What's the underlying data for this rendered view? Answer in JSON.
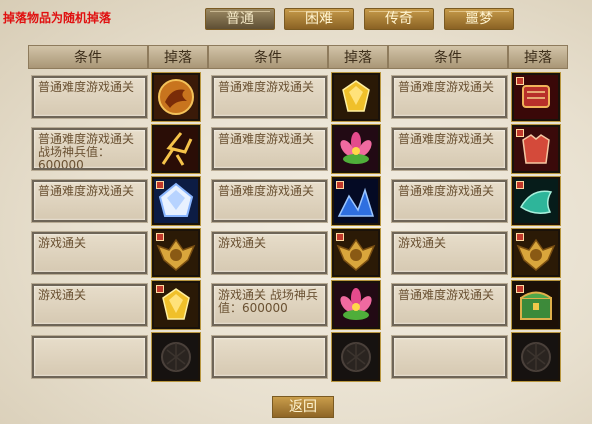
{
  "notice": "掉落物品为随机掉落",
  "tabs": [
    "普通",
    "困难",
    "传奇",
    "噩梦"
  ],
  "active_tab": 0,
  "columns": [
    {
      "header": {
        "condition": "条件",
        "drop": "掉落"
      },
      "rows": [
        {
          "condition": "普通难度游戏通关",
          "icon": "golden-phoenix-orb-icon",
          "marked": false
        },
        {
          "condition": "普通难度游戏通关 战场神兵值：600000",
          "icon": "lightning-antlers-icon",
          "marked": false
        },
        {
          "condition": "普通难度游戏通关",
          "icon": "white-crystal-icon",
          "marked": true
        },
        {
          "condition": "游戏通关",
          "icon": "eagle-medal-icon",
          "marked": true
        },
        {
          "condition": "游戏通关",
          "icon": "golden-gem-icon",
          "marked": true
        },
        {
          "condition": "",
          "icon": "empty-slot-icon",
          "marked": false
        }
      ]
    },
    {
      "header": {
        "condition": "条件",
        "drop": "掉落"
      },
      "rows": [
        {
          "condition": "普通难度游戏通关",
          "icon": "golden-gem-icon",
          "marked": false
        },
        {
          "condition": "普通难度游戏通关",
          "icon": "lotus-flower-icon",
          "marked": false
        },
        {
          "condition": "普通难度游戏通关",
          "icon": "blue-crystal-pile-icon",
          "marked": true
        },
        {
          "condition": "游戏通关",
          "icon": "eagle-medal-icon",
          "marked": true
        },
        {
          "condition": "游戏通关 战场神兵值：600000",
          "icon": "lotus-flower-icon",
          "marked": false
        },
        {
          "condition": "",
          "icon": "empty-slot-icon",
          "marked": false
        }
      ]
    },
    {
      "header": {
        "condition": "条件",
        "drop": "掉落"
      },
      "rows": [
        {
          "condition": "普通难度游戏通关",
          "icon": "red-scroll-icon",
          "marked": true
        },
        {
          "condition": "普通难度游戏通关",
          "icon": "red-armor-icon",
          "marked": true
        },
        {
          "condition": "普通难度游戏通关",
          "icon": "jade-boot-icon",
          "marked": true
        },
        {
          "condition": "游戏通关",
          "icon": "eagle-medal-icon",
          "marked": true
        },
        {
          "condition": "普通难度游戏通关",
          "icon": "treasure-chest-icon",
          "marked": true
        },
        {
          "condition": "",
          "icon": "empty-slot-icon",
          "marked": false
        }
      ]
    }
  ],
  "back_label": "返回"
}
